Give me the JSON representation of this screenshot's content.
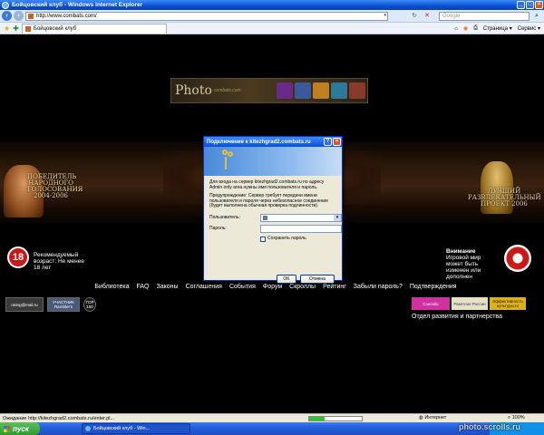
{
  "window": {
    "title": "Бойцовский клуб - Windows Internet Explorer",
    "colors": {
      "titlebar": "#0a4fd6",
      "page_bg": "#000000",
      "dialog_bg": "#ece9d8"
    }
  },
  "address_bar": {
    "url": "http://www.combats.com/"
  },
  "search_bar": {
    "placeholder": "Google"
  },
  "tab": {
    "label": "Бойцовский клуб"
  },
  "command_bar": {
    "page_label": "Страница ▾",
    "tools_label": "Сервис ▾"
  },
  "page": {
    "banner": {
      "text": "Photo",
      "subtitle": "combats.com"
    },
    "award_left": {
      "text": "ПОБЕДИТЕЛЬ НАРОДНОГО ГОЛОСОВАНИЯ 2004-2006"
    },
    "award_right": {
      "text": "ЛУЧШИЙ РАЗВЛЕКАТЕЛЬНЫЙ ПРОЕКТ 2006"
    },
    "age": {
      "badge": "18",
      "text": "Рекомендуемый возраст: Не менее 18 лет"
    },
    "warning": {
      "title": "Внимание",
      "text": "Игровой мир может быть изменен или дополнен"
    },
    "nav_links": [
      "Библиотека",
      "FAQ",
      "Законы",
      "Соглашения",
      "События",
      "Форум",
      "Скроллы",
      "Рейтинг",
      "Забыли пароль?",
      "Подтверждения"
    ],
    "counters": [
      "rating@mail.ru",
      "УЧАСТНИК Rambler's",
      "TOP 100"
    ],
    "partners": [
      "Сэнсейс",
      "Ракетное России",
      "Эффективность культуры.ru"
    ],
    "partners_label": "Отдел развития и партнерства"
  },
  "dialog": {
    "title": "Подключение к kitezhgrad2.combats.ru",
    "message": "Для входа на сервер kitezhgrad2.combats.ru по адресу Admin only area нужны имя пользователя и пароль.",
    "warning": "Предупреждение: Сервер требует передачи имени пользователя и пароля через небезопасное соединение (будет выполнена обычная проверка подлинности).",
    "user_label": "Пользователь:",
    "password_label": "Пароль:",
    "remember_label": "Сохранить пароль",
    "ok_label": "OK",
    "cancel_label": "Отмена"
  },
  "status_bar": {
    "text": "Ожидание http://kitezhgrad2.combats.ru/enter.pl...",
    "progress": 0.3,
    "zone": "Интернет",
    "zoom": "100%"
  },
  "taskbar": {
    "start_label": "пуск",
    "task_label": "Бойцовский клуб - Win...",
    "watermark": "photo.scrolls.ru"
  }
}
